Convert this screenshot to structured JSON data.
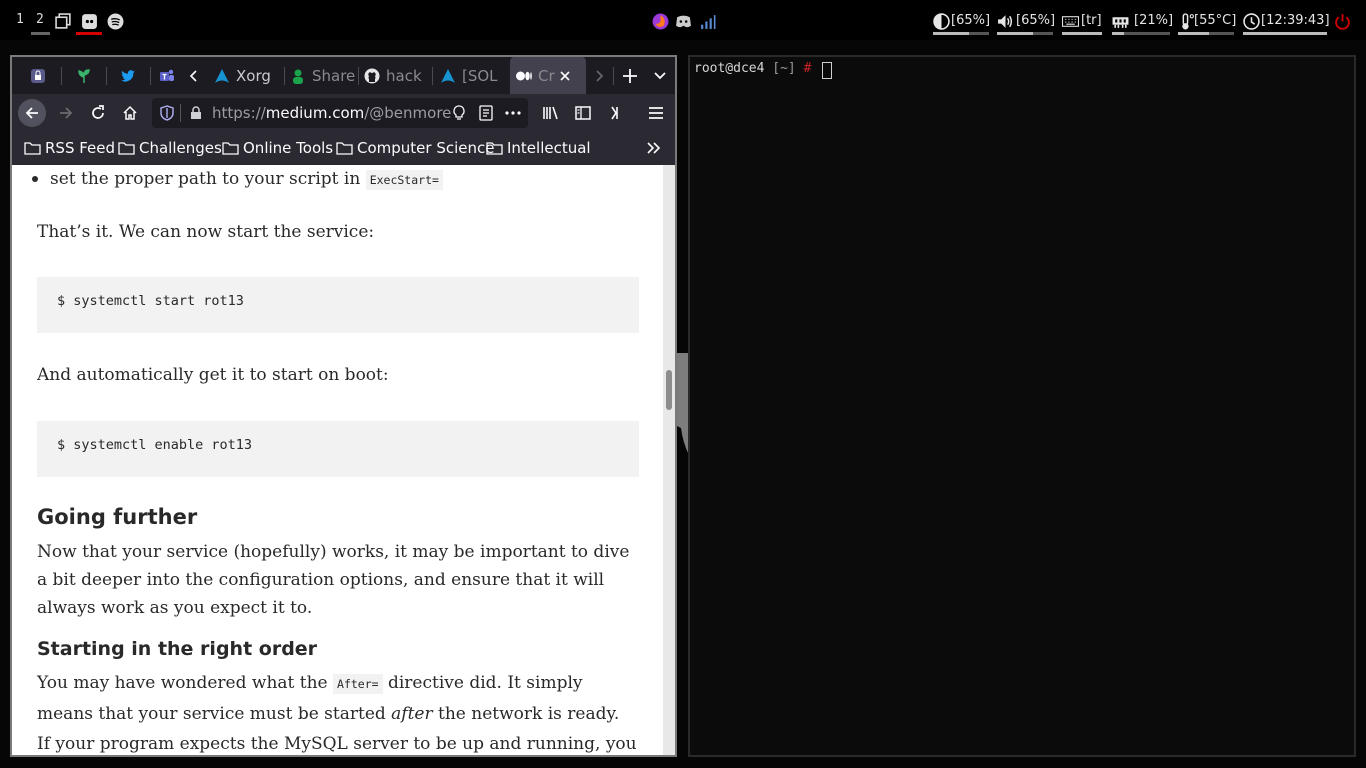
{
  "topbar": {
    "workspaces": [
      "1",
      "2"
    ],
    "status": {
      "brightness": "[65%]",
      "volume": "[65%]",
      "keyboard": "[tr]",
      "memory": "[21%]",
      "temperature": "[55°C]",
      "clock": "[12:39:43]"
    },
    "levels": {
      "brightness": 0.65,
      "volume": 0.65,
      "memory": 0.21,
      "temperature": 0.55
    },
    "accent_color": "#cc0000"
  },
  "browser": {
    "tabs": [
      {
        "label": "",
        "icon": "lock-app-icon"
      },
      {
        "label": "",
        "icon": "plant-icon"
      },
      {
        "label": "",
        "icon": "twitter-icon"
      },
      {
        "label": "",
        "icon": "teams-icon"
      },
      {
        "label": "Xorg",
        "icon": "arch-linux-icon"
      },
      {
        "label": "Share",
        "icon": "share-icon"
      },
      {
        "label": "hack",
        "icon": "github-icon"
      },
      {
        "label": "[SOL",
        "icon": "arch-linux-icon"
      },
      {
        "label": "Cr",
        "icon": "medium-icon"
      }
    ],
    "url_prefix": "https://",
    "url_host": "medium.com",
    "url_path": "/@benmorel/",
    "bookmarks": [
      "RSS Feed",
      "Challenges",
      "Online Tools",
      "Computer Science",
      "Intellectual"
    ]
  },
  "article": {
    "bullet_text": "set the proper path to your script in ",
    "bullet_code": "ExecStart=",
    "para1": "That’s it. We can now start the service:",
    "code1": "$ systemctl start rot13",
    "para2": "And automatically get it to start on boot:",
    "code2": "$ systemctl enable rot13",
    "heading1": "Going further",
    "para3": "Now that your service (hopefully) works, it may be important to dive a bit deeper into the configuration options, and ensure that it will always work as you expect it to.",
    "heading2": "Starting in the right order",
    "para4_a": "You may have wondered what the ",
    "para4_code": "After=",
    "para4_b": " directive did. It simply means that your service must be started ",
    "para4_em": "after",
    "para4_c": " the network is ready. If your program expects the MySQL server to be up and running, you should add:"
  },
  "terminal": {
    "user_host": "root@dce4",
    "cwd": "[~]",
    "prompt_symbol": "#"
  }
}
